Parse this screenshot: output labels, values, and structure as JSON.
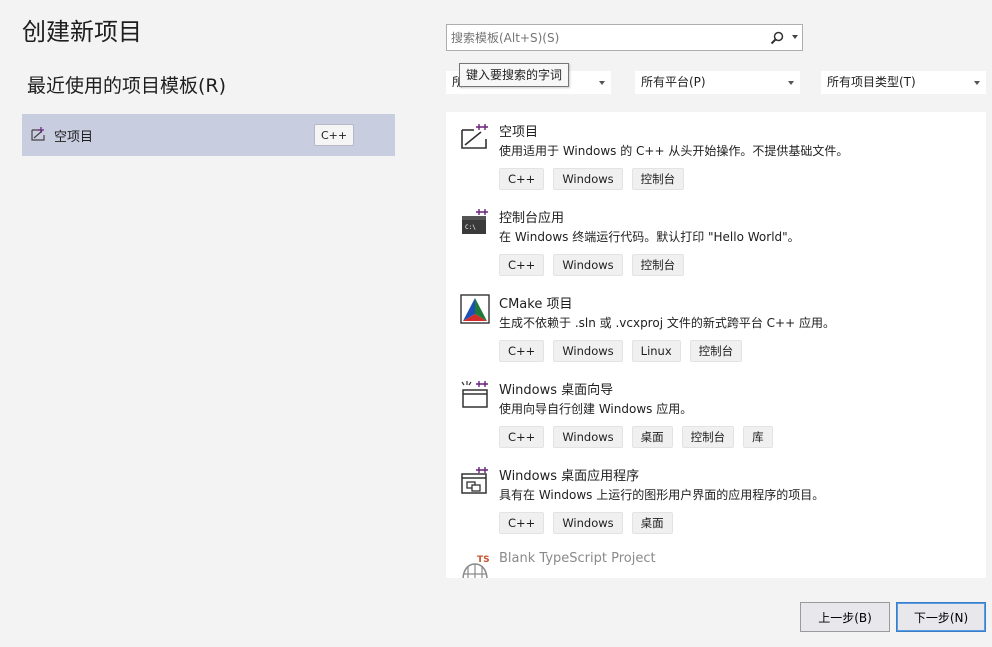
{
  "page": {
    "title": "创建新项目"
  },
  "recent": {
    "heading": "最近使用的项目模板(R)",
    "items": [
      {
        "label": "空项目",
        "tag": "C++",
        "icon": "empty-project-icon"
      }
    ]
  },
  "search": {
    "placeholder": "搜索模板(Alt+S)(S)",
    "tooltip": "键入要搜索的字词",
    "icon": "search-icon"
  },
  "filters": [
    {
      "label": "所",
      "icon": "chevron-down-icon"
    },
    {
      "label": "所有平台(P)",
      "icon": "chevron-down-icon"
    },
    {
      "label": "所有项目类型(T)",
      "icon": "chevron-down-icon"
    }
  ],
  "templates": [
    {
      "name": "空项目",
      "description": "使用适用于 Windows 的 C++ 从头开始操作。不提供基础文件。",
      "tags": [
        "C++",
        "Windows",
        "控制台"
      ],
      "icon": "empty-project-icon"
    },
    {
      "name": "控制台应用",
      "description": "在 Windows 终端运行代码。默认打印 \"Hello World\"。",
      "tags": [
        "C++",
        "Windows",
        "控制台"
      ],
      "icon": "console-app-icon"
    },
    {
      "name": "CMake 项目",
      "description": "生成不依赖于 .sln 或 .vcxproj 文件的新式跨平台 C++ 应用。",
      "tags": [
        "C++",
        "Windows",
        "Linux",
        "控制台"
      ],
      "icon": "cmake-icon"
    },
    {
      "name": "Windows 桌面向导",
      "description": "使用向导自行创建 Windows 应用。",
      "tags": [
        "C++",
        "Windows",
        "桌面",
        "控制台",
        "库"
      ],
      "icon": "desktop-wizard-icon"
    },
    {
      "name": "Windows 桌面应用程序",
      "description": "具有在 Windows 上运行的图形用户界面的应用程序的项目。",
      "tags": [
        "C++",
        "Windows",
        "桌面"
      ],
      "icon": "desktop-app-icon"
    },
    {
      "name": "Blank TypeScript Project",
      "description": "",
      "tags": [],
      "icon": "typescript-icon"
    }
  ],
  "buttons": {
    "back": "上一步(B)",
    "next": "下一步(N)"
  },
  "colors": {
    "selected": "#c9cde0",
    "cpp_purple": "#68217a",
    "accent": "#3a7dc9"
  }
}
